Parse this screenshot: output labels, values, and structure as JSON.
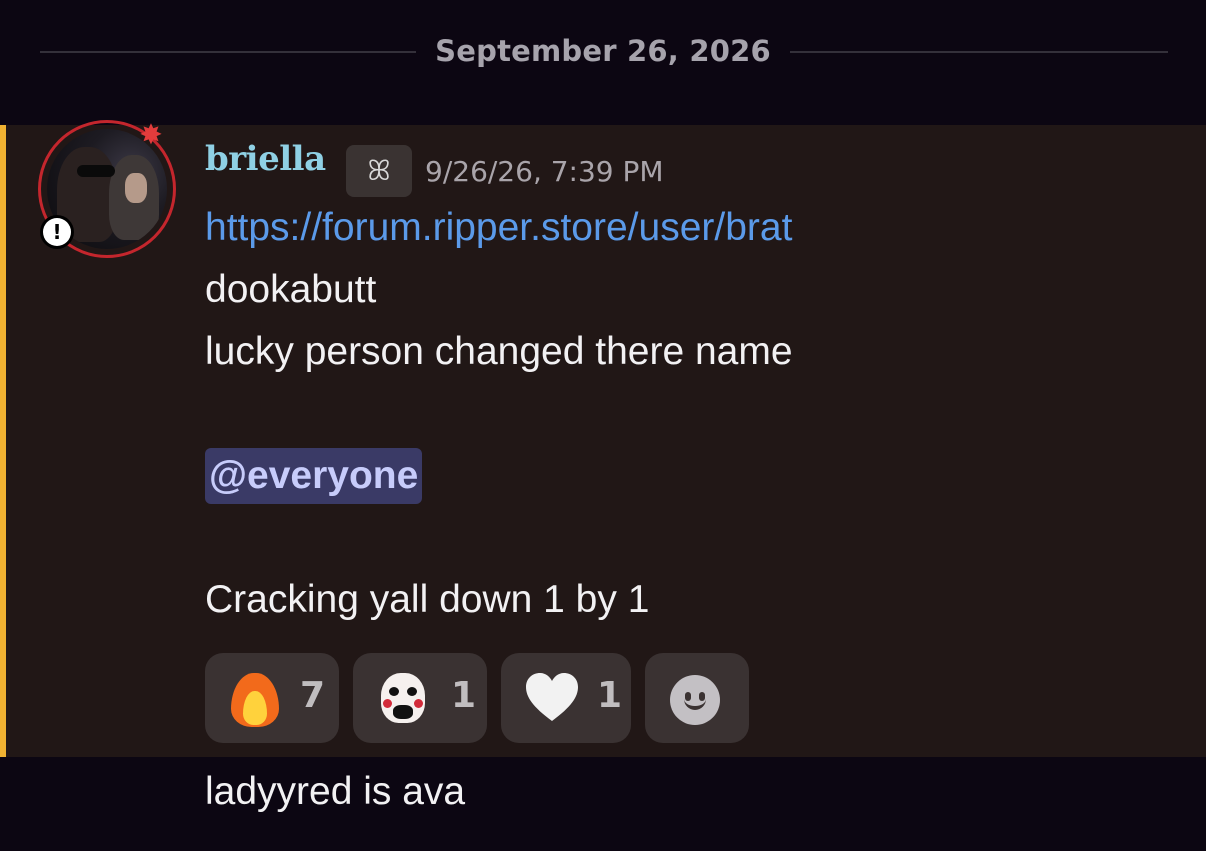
{
  "date_divider": "September 26, 2026",
  "message": {
    "author": "briella",
    "tag_glyph": "ꕤ",
    "timestamp": "9/26/26, 7:39 PM",
    "lines": [
      "https://forum.ripper.store/user/brat",
      "dookabutt",
      "lucky person changed there name",
      "",
      "@everyone",
      "",
      "Cracking yall down 1 by 1"
    ],
    "highlight_color": "#f0b232",
    "avatar_status_badge": "!",
    "avatar_decoration": "anger-icon"
  },
  "reactions": [
    {
      "emoji": "fire-emoji",
      "count": "7"
    },
    {
      "emoji": "puppet-mask-emoji",
      "count": "1"
    },
    {
      "emoji": "white-heart-emoji",
      "count": "1"
    },
    {
      "emoji": "add-reaction-icon",
      "count": ""
    }
  ],
  "next_message": {
    "text": "ladyyred is ava"
  },
  "colors": {
    "username": "#8fd0e4",
    "link": "#5b9ae9",
    "mention_bg": "#3a3a66",
    "mention_text": "#c7ccfb"
  }
}
